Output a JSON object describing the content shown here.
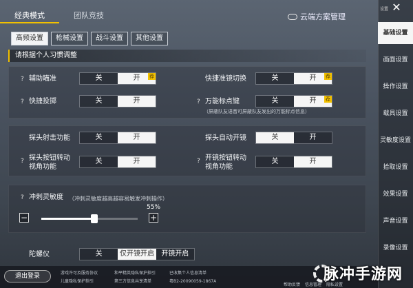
{
  "mode_tabs": [
    "经典模式",
    "团队竞技"
  ],
  "cloud_manage": "云端方案管理",
  "sub_tabs": [
    "高频设置",
    "枪械设置",
    "战斗设置",
    "其他设置"
  ],
  "hint": "请根据个人习惯调整",
  "toggle": {
    "off": "关",
    "on": "开",
    "rec": "荐"
  },
  "rows_a": [
    {
      "label": "辅助瞄准",
      "state": "on",
      "rec": true
    },
    {
      "label": "快捷准镜切换",
      "state": "on",
      "rec": true
    },
    {
      "label": "快捷投掷",
      "state": "on",
      "rec": false
    },
    {
      "label": "万能标点键",
      "state": "on",
      "rec": true,
      "note": "（屏蔽队友语音可屏蔽队友发出的万能标点信息）"
    }
  ],
  "rows_b": [
    {
      "label": "探头射击功能",
      "state": "on",
      "rec": false
    },
    {
      "label": "探头自动开镜",
      "state": "off",
      "rec": false
    },
    {
      "label": "探头按钮转动视角功能",
      "line1": "探头按钮转动",
      "line2": "视角功能",
      "state": "on",
      "rec": false
    },
    {
      "label": "开镜按钮转动视角功能",
      "line1": "开镜按钮转动",
      "line2": "视角功能",
      "state": "on",
      "rec": false
    }
  ],
  "sprint": {
    "label": "冲刺灵敏度",
    "note": "（冲刺灵敏度越高越容易触发冲刺操作）",
    "value_pct": 55,
    "value_text": "55%",
    "minus": "−",
    "plus": "+"
  },
  "partial_row": {
    "label": "陀螺仪",
    "opts": [
      "关",
      "仅开镜开启",
      "开镜开启"
    ]
  },
  "sidebar": {
    "top_label": "设置",
    "close": "✕",
    "items": [
      "基础设置",
      "画面设置",
      "操作设置",
      "载具设置",
      "灵敏度设置",
      "拾取设置",
      "效果设置",
      "声音设置",
      "录像设置"
    ],
    "active": 0
  },
  "bottom": {
    "logout": "退出登录",
    "legal": [
      "游戏许可及服务协议",
      "儿童隐私保护指引",
      "和平精英隐私保护指引",
      "第三方信息共享清单",
      "已收集个人信息清单",
      "粤B2-20090059-1867A"
    ],
    "side_links": [
      "帮助反馈",
      "信息管理",
      "隐私设置"
    ]
  },
  "watermark": "脉冲手游网"
}
